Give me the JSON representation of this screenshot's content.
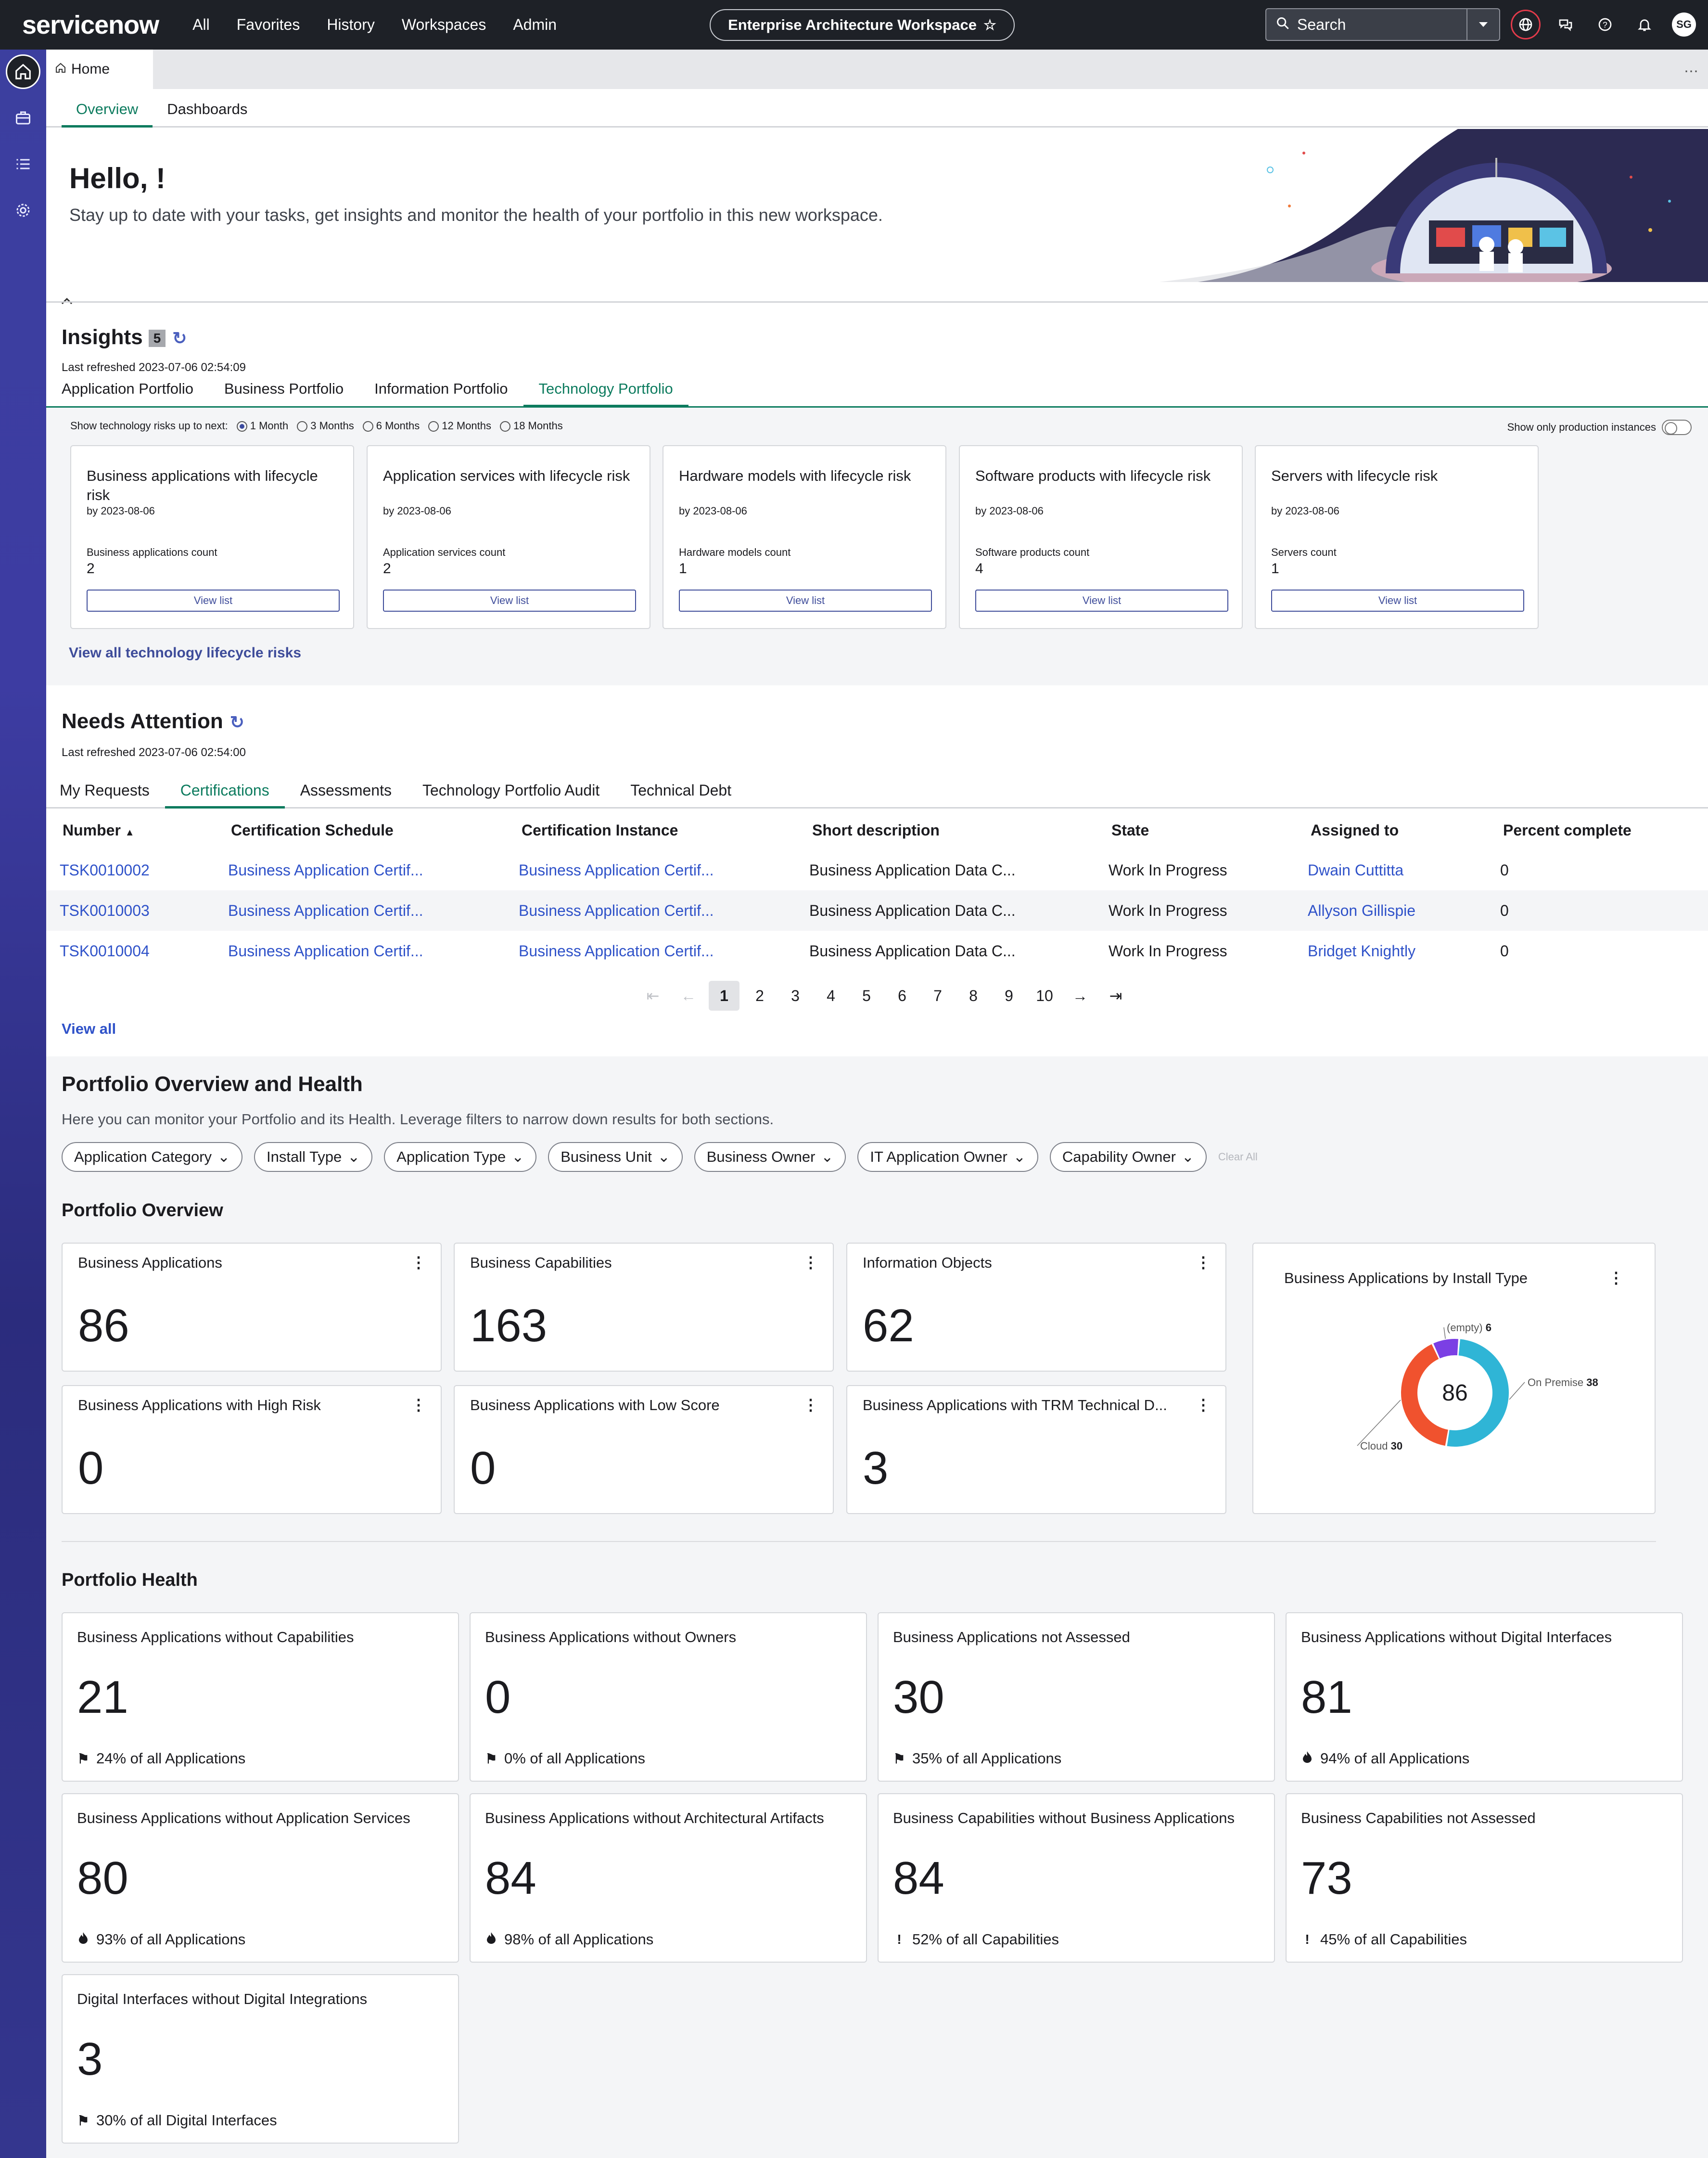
{
  "topnav": {
    "logo": "servicenow",
    "menu": [
      "All",
      "Favorites",
      "History",
      "Workspaces",
      "Admin"
    ],
    "workspace_label": "Enterprise Architecture Workspace",
    "search_placeholder": "Search",
    "avatar_initials": "SG"
  },
  "tabs": {
    "home": "Home",
    "sub": [
      "Overview",
      "Dashboards"
    ]
  },
  "hero": {
    "title": "Hello, !",
    "subtitle": "Stay up to date with your tasks, get insights and monitor the health of your portfolio in this new workspace."
  },
  "insights": {
    "title": "Insights",
    "count": "5",
    "refreshed": "Last refreshed 2023-07-06 02:54:09",
    "tabs": [
      "Application Portfolio",
      "Business Portfolio",
      "Information Portfolio",
      "Technology Portfolio"
    ],
    "risk_label": "Show technology risks up to next:",
    "periods": [
      "1 Month",
      "3 Months",
      "6 Months",
      "12 Months",
      "18 Months"
    ],
    "prod_toggle": "Show only production instances",
    "cards": [
      {
        "title": "Business applications with lifecycle risk",
        "by": "by 2023-08-06",
        "label": "Business applications count",
        "count": "2",
        "button": "View list"
      },
      {
        "title": "Application services with lifecycle risk",
        "by": "by 2023-08-06",
        "label": "Application services count",
        "count": "2",
        "button": "View list"
      },
      {
        "title": "Hardware models with lifecycle risk",
        "by": "by 2023-08-06",
        "label": "Hardware models count",
        "count": "1",
        "button": "View list"
      },
      {
        "title": "Software products with lifecycle risk",
        "by": "by 2023-08-06",
        "label": "Software products count",
        "count": "4",
        "button": "View list"
      },
      {
        "title": "Servers with lifecycle risk",
        "by": "by 2023-08-06",
        "label": "Servers count",
        "count": "1",
        "button": "View list"
      }
    ],
    "view_all": "View all technology lifecycle risks"
  },
  "needs_attention": {
    "title": "Needs Attention",
    "refreshed": "Last refreshed 2023-07-06 02:54:00",
    "tabs": [
      "My Requests",
      "Certifications",
      "Assessments",
      "Technology Portfolio Audit",
      "Technical Debt"
    ],
    "columns": [
      "Number",
      "Certification Schedule",
      "Certification Instance",
      "Short description",
      "State",
      "Assigned to",
      "Percent complete"
    ],
    "rows": [
      {
        "number": "TSK0010002",
        "schedule": "Business Application Certif...",
        "instance": "Business Application Certif...",
        "desc": "Business Application Data C...",
        "state": "Work In Progress",
        "assigned": "Dwain Cuttitta",
        "percent": "0"
      },
      {
        "number": "TSK0010003",
        "schedule": "Business Application Certif...",
        "instance": "Business Application Certif...",
        "desc": "Business Application Data C...",
        "state": "Work In Progress",
        "assigned": "Allyson Gillispie",
        "percent": "0"
      },
      {
        "number": "TSK0010004",
        "schedule": "Business Application Certif...",
        "instance": "Business Application Certif...",
        "desc": "Business Application Data C...",
        "state": "Work In Progress",
        "assigned": "Bridget Knightly",
        "percent": "0"
      }
    ],
    "pages": [
      "1",
      "2",
      "3",
      "4",
      "5",
      "6",
      "7",
      "8",
      "9",
      "10"
    ],
    "current_page": "1",
    "view_all": "View all"
  },
  "portfolio": {
    "title": "Portfolio Overview and Health",
    "subtitle": "Here you can monitor your Portfolio and its Health. Leverage filters to narrow down results for both sections.",
    "filters": [
      "Application Category",
      "Install Type",
      "Application Type",
      "Business Unit",
      "Business Owner",
      "IT Application Owner",
      "Capability Owner"
    ],
    "clear_all": "Clear All",
    "overview_title": "Portfolio Overview",
    "overview_cards": [
      {
        "title": "Business Applications",
        "value": "86"
      },
      {
        "title": "Business Capabilities",
        "value": "163"
      },
      {
        "title": "Information Objects",
        "value": "62"
      },
      {
        "title": "Business Applications with High Risk",
        "value": "0"
      },
      {
        "title": "Business Applications with Low Score",
        "value": "0"
      },
      {
        "title": "Business Applications with TRM Technical D...",
        "value": "3"
      }
    ],
    "donut": {
      "title": "Business Applications by Install Type",
      "total": "86",
      "colors": {
        "on_premise": "#2fb5d6",
        "cloud": "#f0522e",
        "empty": "#7b3fe4",
        "other": "#d63fb0"
      }
    },
    "health_title": "Portfolio Health",
    "health_cards": [
      {
        "title": "Business Applications without Capabilities",
        "value": "21",
        "footer": "24% of all Applications",
        "icon": "flag-icon"
      },
      {
        "title": "Business Applications without Owners",
        "value": "0",
        "footer": "0% of all Applications",
        "icon": "flag-icon"
      },
      {
        "title": "Business Applications not Assessed",
        "value": "30",
        "footer": "35% of all Applications",
        "icon": "flag-icon"
      },
      {
        "title": "Business Applications without Digital Interfaces",
        "value": "81",
        "footer": "94% of all Applications",
        "icon": "fire-icon"
      },
      {
        "title": "Business Applications without Application Services",
        "value": "80",
        "footer": "93% of all Applications",
        "icon": "fire-icon"
      },
      {
        "title": "Business Applications without Architectural Artifacts",
        "value": "84",
        "footer": "98% of all Applications",
        "icon": "fire-icon"
      },
      {
        "title": "Business Capabilities without Business Applications",
        "value": "84",
        "footer": "52% of all Capabilities",
        "icon": "exclamation-icon"
      },
      {
        "title": "Business Capabilities not Assessed",
        "value": "73",
        "footer": "45% of all Capabilities",
        "icon": "exclamation-icon"
      },
      {
        "title": "Digital Interfaces without Digital Integrations",
        "value": "3",
        "footer": "30% of all Digital Interfaces",
        "icon": "flag-icon"
      }
    ]
  },
  "chart_data": {
    "type": "pie",
    "title": "Business Applications by Install Type",
    "categories": [
      "On Premise",
      "Cloud",
      "(empty)"
    ],
    "values": [
      38,
      30,
      6
    ],
    "total": 86
  }
}
